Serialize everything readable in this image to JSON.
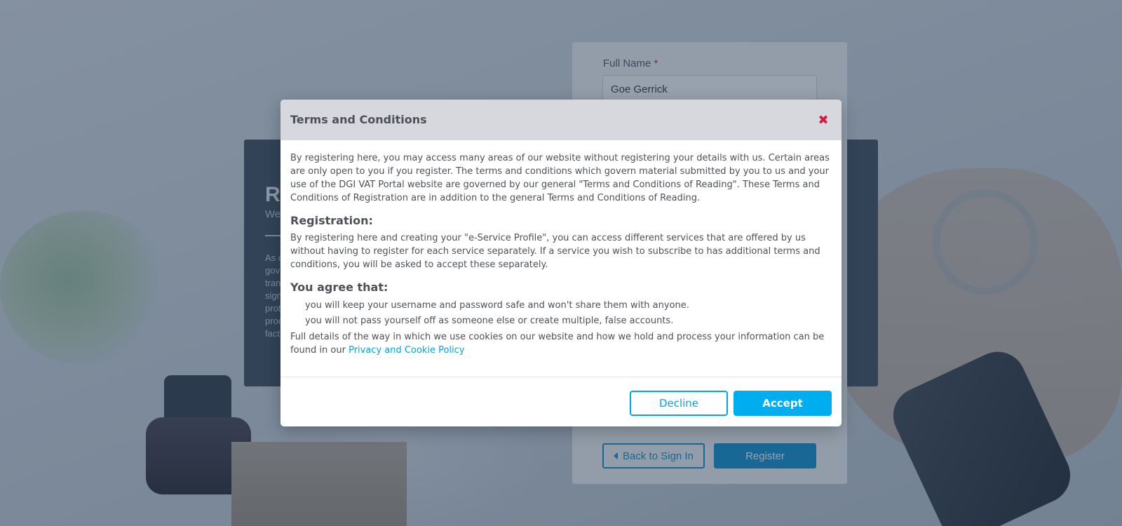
{
  "background_page": {
    "info_panel": {
      "title": "Re",
      "subtitle": "We",
      "body_fragments": [
        "As c",
        "gov",
        "tran",
        "sign",
        "prot",
        "proc",
        "fact"
      ]
    },
    "form": {
      "full_name_label": "Full Name",
      "required_marker": "*",
      "full_name_value": "Goe Gerrick",
      "back_button_label": "Back to Sign In",
      "back_icon": "caret-left-icon",
      "register_button_label": "Register"
    }
  },
  "modal": {
    "title": "Terms and Conditions",
    "close_icon": "close-icon",
    "close_glyph": "✖",
    "intro": "By registering here, you may access many areas of our website without registering your details with us. Certain areas are only open to you if you register. The terms and conditions which govern material submitted by you to us and your use of the DGI VAT Portal website are governed by our general \"Terms and Conditions of Reading\". These Terms and Conditions of Registration are in addition to the general Terms and Conditions of Reading.",
    "registration_heading": "Registration:",
    "registration_text": "By registering here and creating your \"e-Service Profile\", you can access different services that are offered by us without having to register for each service separately. If a service you wish to subscribe to has additional terms and conditions, you will be asked to accept these separately.",
    "agree_heading": "You agree that:",
    "agree_items": [
      "you will keep your username and password safe and won't share them with anyone.",
      "you will not pass yourself off as someone else or create multiple, false accounts."
    ],
    "cookies_text": "Full details of the way in which we use cookies on our website and how we hold and process your information can be found in our",
    "policy_link": "Privacy and Cookie Policy",
    "decline_label": "Decline",
    "accept_label": "Accept"
  },
  "colors": {
    "accent": "#00aeef",
    "close": "#e0153f",
    "header_bg": "#d6d8de",
    "text": "#4d5157"
  }
}
